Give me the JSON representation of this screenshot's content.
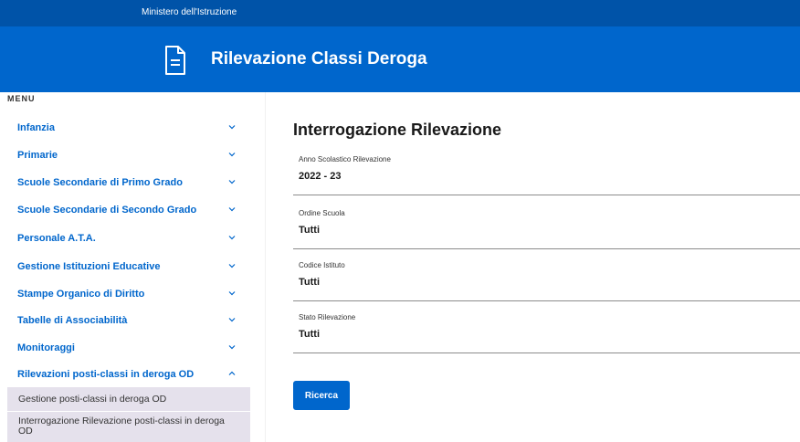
{
  "topbar": {
    "ministry": "Ministero dell'Istruzione"
  },
  "header": {
    "title": "Rilevazione Classi Deroga",
    "icon": "document-icon"
  },
  "sidebar": {
    "menu_label": "MENU",
    "items": [
      {
        "label": "Infanzia",
        "expanded": false
      },
      {
        "label": "Primarie",
        "expanded": false
      },
      {
        "label": "Scuole Secondarie di Primo Grado",
        "expanded": false
      },
      {
        "label": "Scuole Secondarie di Secondo Grado",
        "expanded": false
      },
      {
        "label": "Personale A.T.A.",
        "expanded": false
      },
      {
        "label": "Gestione Istituzioni Educative",
        "expanded": false
      },
      {
        "label": "Stampe Organico di Diritto",
        "expanded": false
      },
      {
        "label": "Tabelle di Associabilità",
        "expanded": false
      },
      {
        "label": "Monitoraggi",
        "expanded": false
      },
      {
        "label": "Rilevazioni posti-classi in deroga OD",
        "expanded": true
      }
    ],
    "subitems": [
      {
        "label": "Gestione posti-classi in deroga OD"
      },
      {
        "label": "Interrogazione Rilevazione posti-classi in deroga OD"
      }
    ]
  },
  "main": {
    "title": "Interrogazione Rilevazione",
    "fields": [
      {
        "label": "Anno Scolastico Rilevazione",
        "value": "2022 - 23"
      },
      {
        "label": "Ordine Scuola",
        "value": "Tutti"
      },
      {
        "label": "Codice Istituto",
        "value": "Tutti"
      },
      {
        "label": "Stato Rilevazione",
        "value": "Tutti"
      }
    ],
    "search_button": "Ricerca"
  },
  "colors": {
    "topbar": "#0053a8",
    "header": "#0066cc",
    "link": "#0066cc",
    "submenu_bg": "#e5e1ec"
  }
}
